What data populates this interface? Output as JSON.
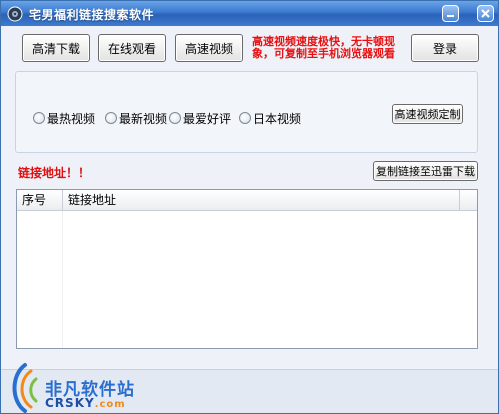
{
  "window": {
    "title": "宅男福利链接搜索软件"
  },
  "toolbar": {
    "hd_download": "高清下载",
    "online_watch": "在线观看",
    "fast_video": "高速视频",
    "login": "登录"
  },
  "notice": {
    "text": "高速视频速度极快，无卡顿现象，可复制至手机浏览器观看"
  },
  "filters": {
    "options": [
      {
        "label": "最热视频"
      },
      {
        "label": "最新视频"
      },
      {
        "label": "最爱好评"
      },
      {
        "label": "日本视频"
      }
    ],
    "custom_button": "高速视频定制"
  },
  "links": {
    "label": "链接地址！！",
    "copy_button": "复制链接至迅雷下载"
  },
  "table": {
    "columns": [
      "序号",
      "链接地址"
    ],
    "rows": []
  },
  "watermark": {
    "cn": "非凡软件站",
    "en_main": "CRSKY",
    "en_domain": ".com"
  },
  "colors": {
    "titlebar": "#3a79cf",
    "alert_red": "#e81010",
    "logo_blue": "#2a6fcf"
  }
}
